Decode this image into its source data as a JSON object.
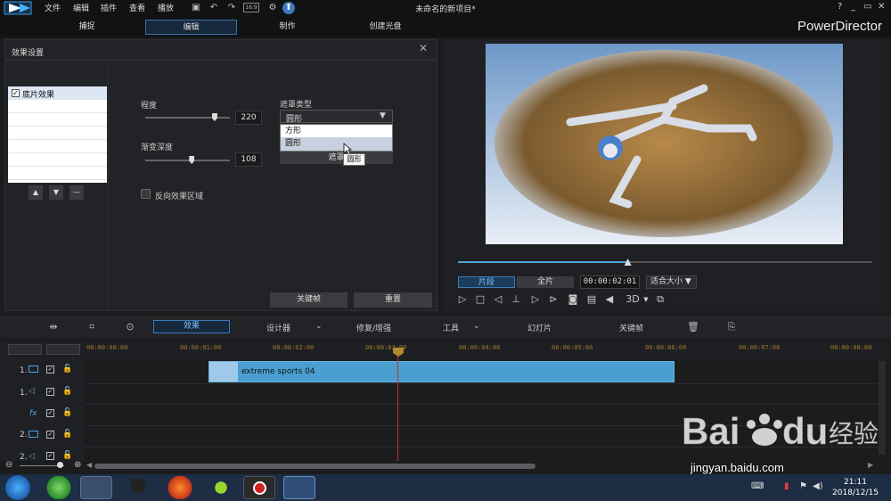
{
  "app": {
    "menus": [
      "文件",
      "编辑",
      "插件",
      "查看",
      "播放"
    ],
    "doc_title": "未命名的新项目*",
    "brand": "PowerDirector",
    "window_controls": [
      "?",
      "_",
      "▭",
      "✕"
    ]
  },
  "modes": [
    "捕捉",
    "编辑",
    "制作",
    "创建光盘"
  ],
  "effect_panel": {
    "title": "效果设置",
    "effect_list": [
      {
        "label": "底片效果",
        "checked": true
      }
    ],
    "degree_label": "程度",
    "degree_value": "220",
    "degree_level": 0.82,
    "gradient_label": "渐变深度",
    "gradient_value": "108",
    "gradient_level": 0.55,
    "reverse_label": "反向效果区域",
    "mask_type_label": "遮罩类型",
    "mask_selected": "圆形",
    "mask_options": [
      "方形",
      "圆形"
    ],
    "mask_button_label": "遮罩",
    "tooltip": "圆形",
    "keyframe_label": "关键帧",
    "reset_label": "重置"
  },
  "preview": {
    "progress": 0.41,
    "clip_mode": "片段",
    "full_mode": "全片",
    "timecode": "00:00:02:01",
    "fit": "适合大小",
    "threed": "3D"
  },
  "toolbar": {
    "effects": "效果",
    "designer": "设计器",
    "repair": "修复/增强",
    "tools": "工具",
    "slideshow": "幻灯片",
    "keyframe": "关键帧"
  },
  "timeline": {
    "ticks": [
      "00:00:00:00",
      "00:00:01:00",
      "00:00:02:00",
      "00:00:03:00",
      "00:00:04:00",
      "00:00:05:00",
      "00:00:06:00",
      "00:00:07:00",
      "00:00:08:00"
    ],
    "tracks": [
      "1.",
      "1.",
      "fx",
      "2.",
      "2."
    ],
    "clip_name": "extreme sports 04"
  },
  "taskbar": {
    "time": "21:11",
    "date": "2018/12/15"
  },
  "watermark": {
    "logo_text": "Bai du 经验",
    "url": "jingyan.baidu.com"
  },
  "colors": {
    "accent": "#3c7bbd",
    "clip": "#4a9fd0",
    "playhead": "#c0362c"
  }
}
